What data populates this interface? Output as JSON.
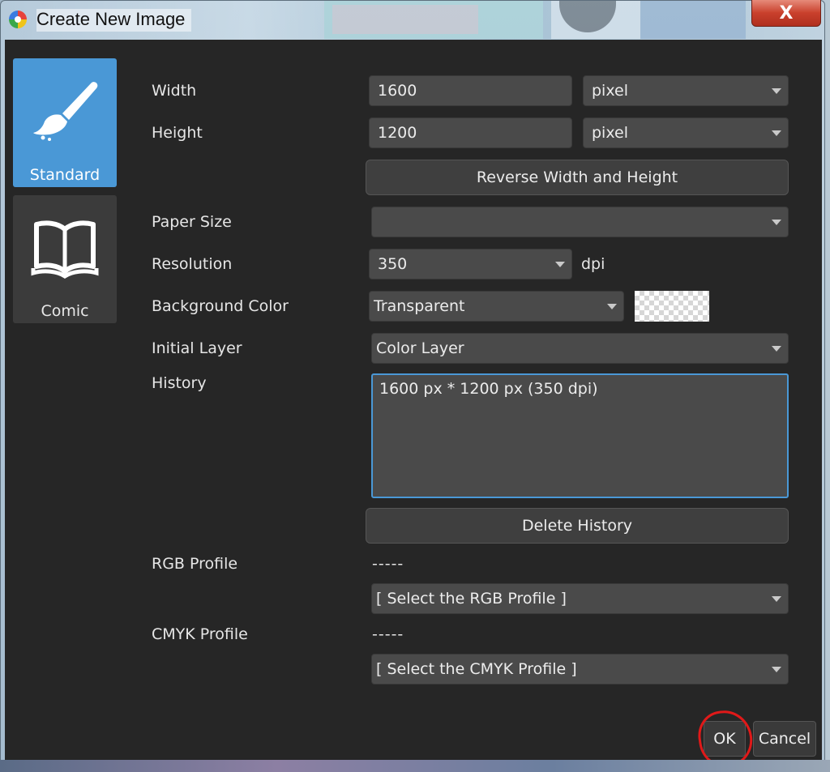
{
  "window": {
    "title": "Create New Image",
    "close_label": "X"
  },
  "sidebar": {
    "items": [
      {
        "label": "Standard",
        "icon": "paintbrush-icon",
        "selected": true
      },
      {
        "label": "Comic",
        "icon": "open-book-icon",
        "selected": false
      }
    ]
  },
  "form": {
    "width": {
      "label": "Width",
      "value": "1600",
      "unit": "pixel"
    },
    "height": {
      "label": "Height",
      "value": "1200",
      "unit": "pixel"
    },
    "reverse_button": "Reverse Width and Height",
    "paper_size": {
      "label": "Paper Size",
      "value": ""
    },
    "resolution": {
      "label": "Resolution",
      "value": "350",
      "unit": "dpi"
    },
    "background_color": {
      "label": "Background Color",
      "value": "Transparent"
    },
    "initial_layer": {
      "label": "Initial Layer",
      "value": "Color Layer"
    },
    "history": {
      "label": "History",
      "entries": [
        "1600 px * 1200 px (350 dpi)"
      ]
    },
    "delete_history_button": "Delete History",
    "rgb_profile": {
      "label": "RGB Profile",
      "current": "-----",
      "select": "[ Select the RGB Profile ]"
    },
    "cmyk_profile": {
      "label": "CMYK Profile",
      "current": "-----",
      "select": "[ Select the CMYK Profile ]"
    }
  },
  "footer": {
    "ok_label": "OK",
    "cancel_label": "Cancel"
  },
  "colors": {
    "accent": "#4a98d6",
    "dialog_bg": "#262626",
    "annotation": "#e01919"
  }
}
